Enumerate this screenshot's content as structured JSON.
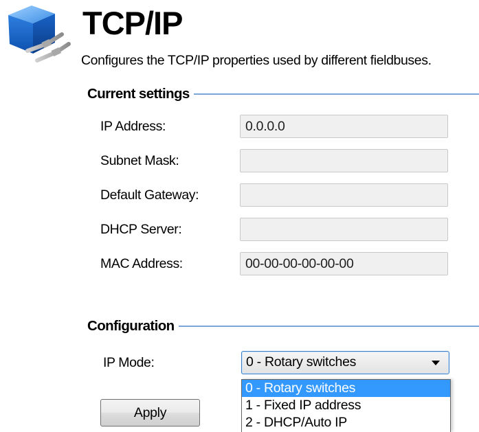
{
  "header": {
    "title": "TCP/IP",
    "description": "Configures the TCP/IP properties used by different fieldbuses.",
    "icon": "network-cube-icon"
  },
  "current_settings": {
    "heading": "Current settings",
    "fields": [
      {
        "label": "IP Address:",
        "value": "0.0.0.0"
      },
      {
        "label": "Subnet Mask:",
        "value": ""
      },
      {
        "label": "Default Gateway:",
        "value": ""
      },
      {
        "label": "DHCP Server:",
        "value": ""
      },
      {
        "label": "MAC Address:",
        "value": "00-00-00-00-00-00"
      }
    ]
  },
  "configuration": {
    "heading": "Configuration",
    "ip_mode_label": "IP Mode:",
    "ip_mode_selected": "0 - Rotary switches",
    "ip_mode_options": [
      "0 - Rotary switches",
      "1 - Fixed IP address",
      "2 - DHCP/Auto IP"
    ],
    "apply_label": "Apply"
  },
  "colors": {
    "accent": "#3399ff",
    "section_rule": "#7aa6d8",
    "icon_blue": "#1f6fd1"
  }
}
